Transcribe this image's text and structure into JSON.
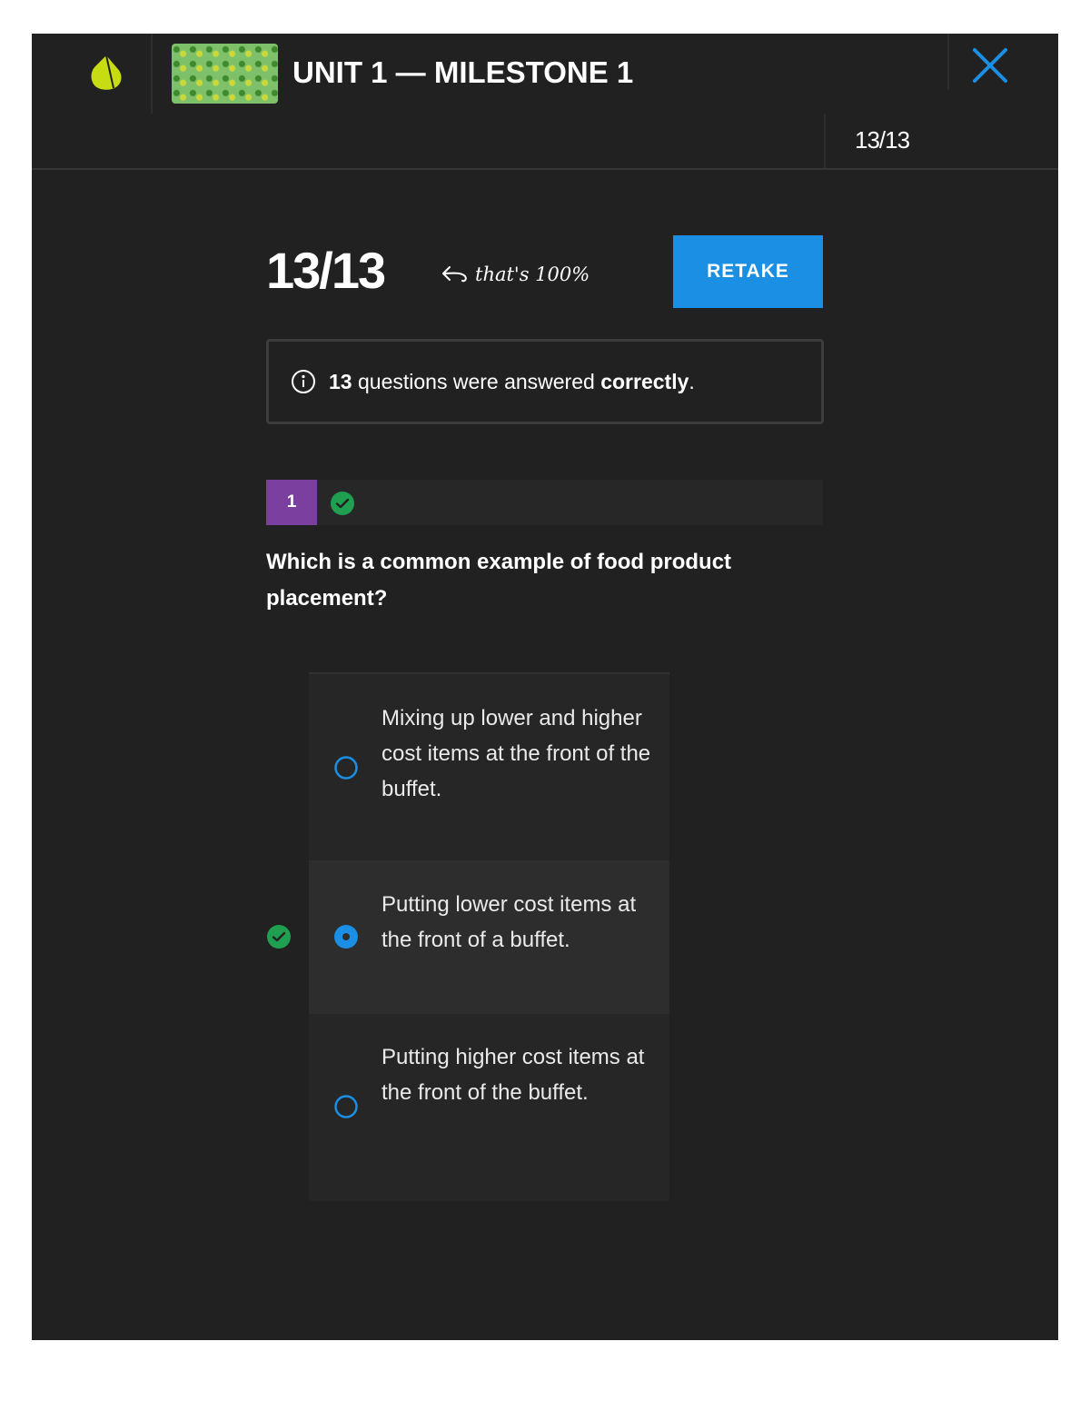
{
  "header": {
    "unit_title": "UNIT 1 — MILESTONE 1",
    "progress": "13/13",
    "logo_icon": "sophia-logo-icon",
    "close_icon": "close-icon"
  },
  "score": {
    "value": "13/13",
    "note": "that's 100%",
    "retake_label": "RETAKE"
  },
  "summary": {
    "count": "13",
    "text_before": " questions were answered ",
    "emphasis": "correctly",
    "text_after": "."
  },
  "question": {
    "number": "1",
    "status": "correct",
    "text": "Which is a common example of food product placement?",
    "answers": [
      {
        "text": "Mixing up lower and higher cost items at the front of the buffet.",
        "selected": false,
        "correct": false
      },
      {
        "text": "Putting lower cost items at the front of a buffet.",
        "selected": true,
        "correct": true
      },
      {
        "text": "Putting higher cost items at the front of the buffet.",
        "selected": false,
        "correct": false
      }
    ]
  },
  "colors": {
    "background": "#212121",
    "accent_blue": "#1a8fe3",
    "question_badge": "#7b3fa0",
    "correct_green": "#1fa050",
    "logo_yellow": "#c8dc14"
  }
}
